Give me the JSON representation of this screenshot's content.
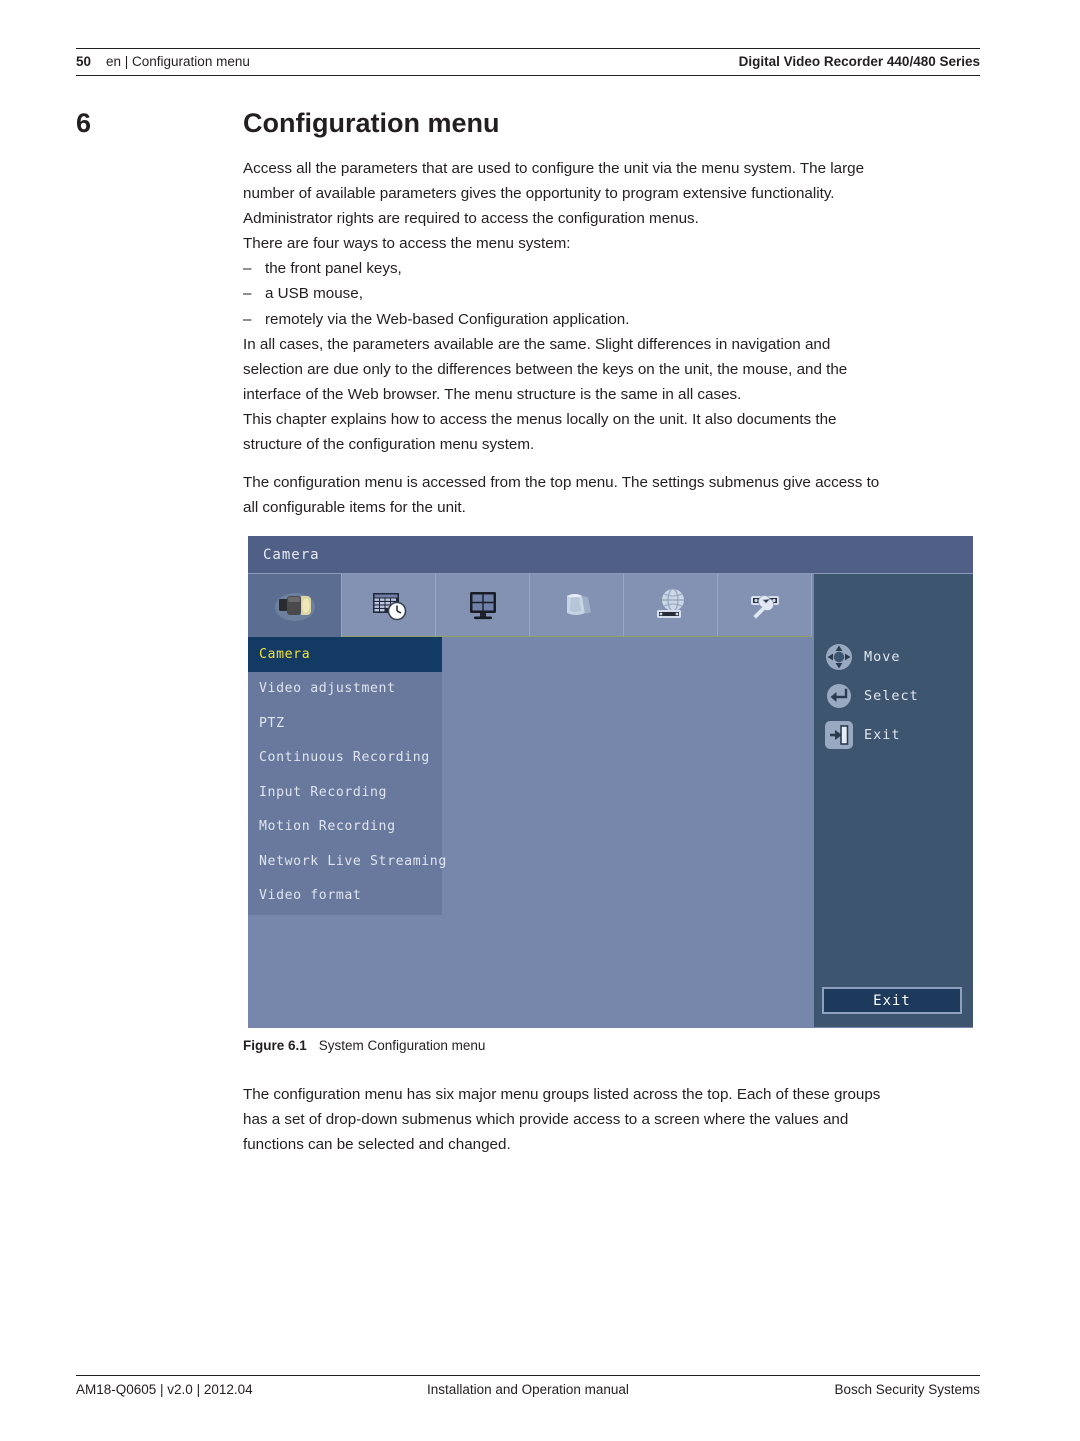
{
  "header": {
    "page_number": "50",
    "left_text": "en | Configuration menu",
    "right_text": "Digital Video Recorder 440/480 Series"
  },
  "chapter": {
    "number": "6",
    "title": "Configuration menu"
  },
  "body": {
    "paragraph_1_line_1": "Access all the parameters that are used to configure the unit via the menu system. The large",
    "paragraph_1_line_2": "number of available parameters gives the opportunity to program extensive functionality.",
    "paragraph_1_line_3": "Administrator rights are required to access the configuration menus.",
    "paragraph_2": "There are four ways to access the menu system:",
    "bullet_dash": "–",
    "bullets": [
      "the front panel keys,",
      "a USB mouse,",
      "remotely via the Web-based Configuration application."
    ],
    "paragraph_3_line_1": "In all cases, the parameters available are the same. Slight differences in navigation and",
    "paragraph_3_line_2": "selection are due only to the differences between the keys on the unit, the mouse, and the",
    "paragraph_3_line_3": "interface of the Web browser. The menu structure is the same in all cases.",
    "paragraph_4_line_1": "This chapter explains how to access the menus locally on the unit. It also documents the",
    "paragraph_4_line_2": "structure of the configuration menu system.",
    "paragraph_5_line_1": "The configuration menu is accessed from the top menu. The settings submenus give access to",
    "paragraph_5_line_2": "all configurable items for the unit.",
    "paragraph_6_line_1": "The configuration menu has six major menu groups listed across the top. Each of these groups",
    "paragraph_6_line_2": "has a set of drop-down submenus which provide access to a screen where the values and",
    "paragraph_6_line_3": "functions can be selected and changed."
  },
  "figure": {
    "caption_label": "Figure 6.1",
    "caption_text": "System Configuration menu",
    "dvr": {
      "titlebar": "Camera",
      "tabs": [
        {
          "icon": "camera-icon",
          "selected": true
        },
        {
          "icon": "schedule-clock-icon",
          "selected": false
        },
        {
          "icon": "monitor-icon",
          "selected": false
        },
        {
          "icon": "storage-disk-icon",
          "selected": false
        },
        {
          "icon": "network-globe-icon",
          "selected": false
        },
        {
          "icon": "wrench-system-icon",
          "selected": false
        }
      ],
      "menu_items": [
        {
          "label": "Camera",
          "active": true
        },
        {
          "label": "Video adjustment",
          "active": false
        },
        {
          "label": "PTZ",
          "active": false
        },
        {
          "label": "Continuous Recording",
          "active": false
        },
        {
          "label": "Input Recording",
          "active": false
        },
        {
          "label": "Motion Recording",
          "active": false
        },
        {
          "label": "Network Live Streaming",
          "active": false
        },
        {
          "label": "Video format",
          "active": false
        }
      ],
      "hints": [
        {
          "icon": "dpad-move-icon",
          "label": "Move"
        },
        {
          "icon": "enter-select-icon",
          "label": "Select"
        },
        {
          "icon": "exit-arrow-icon",
          "label": "Exit"
        }
      ],
      "exit_button_label": "Exit",
      "colors": {
        "titlebar": "#505f85",
        "content": "#7687ab",
        "menu_panel": "#69799d",
        "menu_active": "#133a62",
        "menu_active_text": "#f3e03a",
        "right_panel": "#3d556e",
        "exit_button": "#1d3a5c"
      }
    }
  },
  "footer": {
    "left": "AM18-Q0605 | v2.0 | 2012.04",
    "center": "Installation and Operation manual",
    "right": "Bosch Security Systems"
  }
}
